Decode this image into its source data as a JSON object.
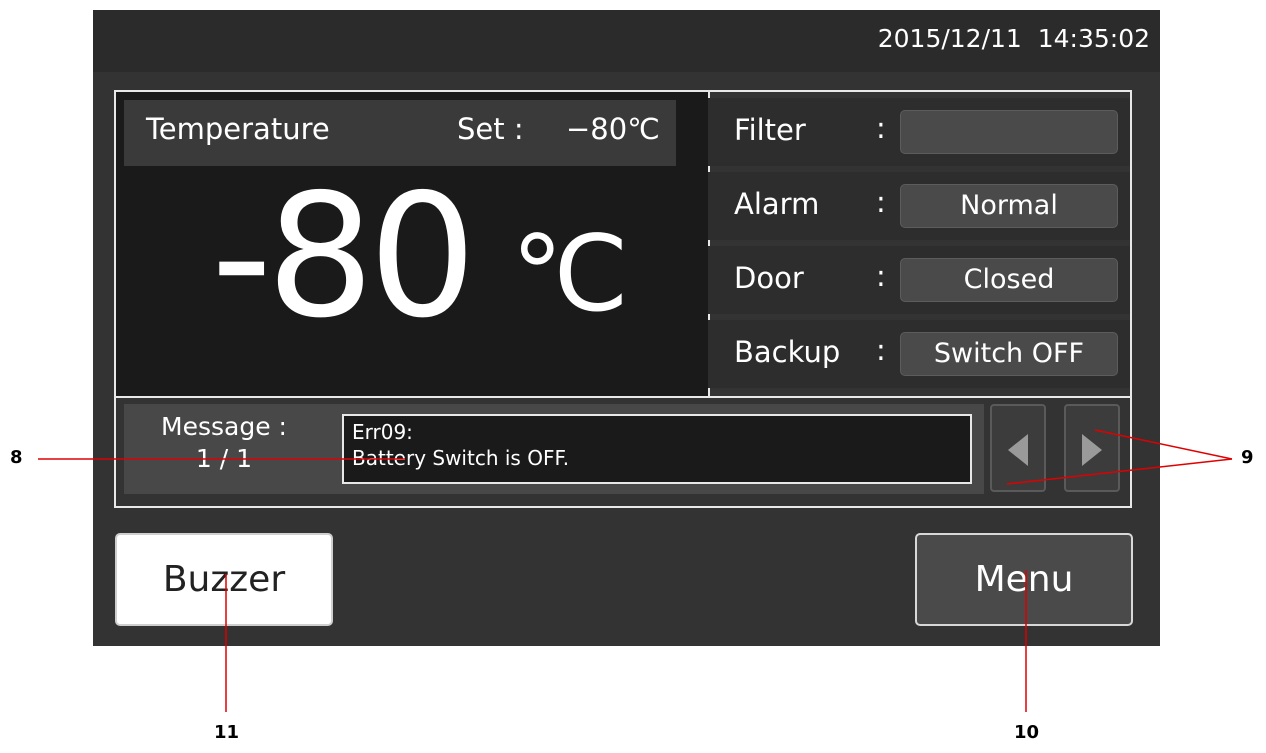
{
  "header": {
    "datetime": "2015/12/11  14:35:02"
  },
  "temperature": {
    "title": "Temperature",
    "set_label": "Set :",
    "set_value": "−80℃",
    "current_value": "-80",
    "unit": "℃"
  },
  "status": [
    {
      "label": "Filter",
      "colon": ":",
      "value": ""
    },
    {
      "label": "Alarm",
      "colon": ":",
      "value": "Normal"
    },
    {
      "label": "Door",
      "colon": ":",
      "value": "Closed"
    },
    {
      "label": "Backup",
      "colon": ":",
      "value": "Switch OFF"
    }
  ],
  "message": {
    "label": "Message :",
    "page": "1 / 1",
    "line1": "Err09:",
    "line2": "Battery Switch is OFF."
  },
  "buttons": {
    "buzzer": "Buzzer",
    "menu": "Menu"
  },
  "callouts": {
    "c8": "8",
    "c9": "9",
    "c10": "10",
    "c11": "11"
  },
  "icons": {
    "prev": "triangle-left-icon",
    "next": "triangle-right-icon"
  }
}
